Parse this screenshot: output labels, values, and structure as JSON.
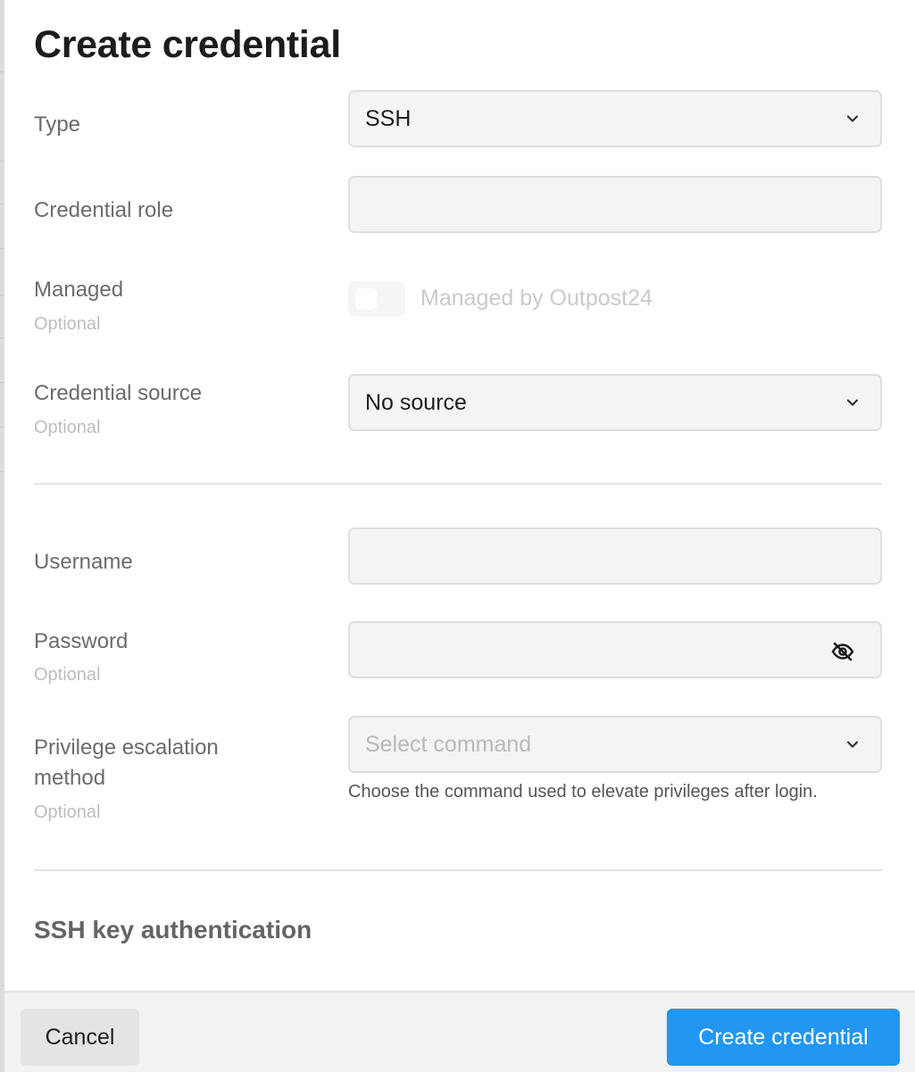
{
  "dialog": {
    "title": "Create credential",
    "section_heading": "SSH key authentication"
  },
  "form": {
    "type": {
      "label": "Type",
      "value": "SSH"
    },
    "credential_role": {
      "label": "Credential role",
      "value": ""
    },
    "managed": {
      "label": "Managed",
      "optional": "Optional",
      "toggle_label": "Managed by Outpost24",
      "enabled": false
    },
    "credential_source": {
      "label": "Credential source",
      "optional": "Optional",
      "value": "No source"
    },
    "username": {
      "label": "Username",
      "value": ""
    },
    "password": {
      "label": "Password",
      "optional": "Optional",
      "value": ""
    },
    "privilege_escalation": {
      "label_line1": "Privilege escalation",
      "label_line2": "method",
      "optional": "Optional",
      "placeholder": "Select command",
      "help": "Choose the command used to elevate privileges after login."
    }
  },
  "footer": {
    "cancel_label": "Cancel",
    "create_label": "Create credential"
  },
  "colors": {
    "primary": "#2196f3",
    "field_bg": "#f4f4f4",
    "label": "#6b6b6b",
    "optional": "#bdbdbd"
  },
  "icons": {
    "select_arrow": "chevron-down-icon",
    "password_toggle": "eye-off-icon"
  }
}
